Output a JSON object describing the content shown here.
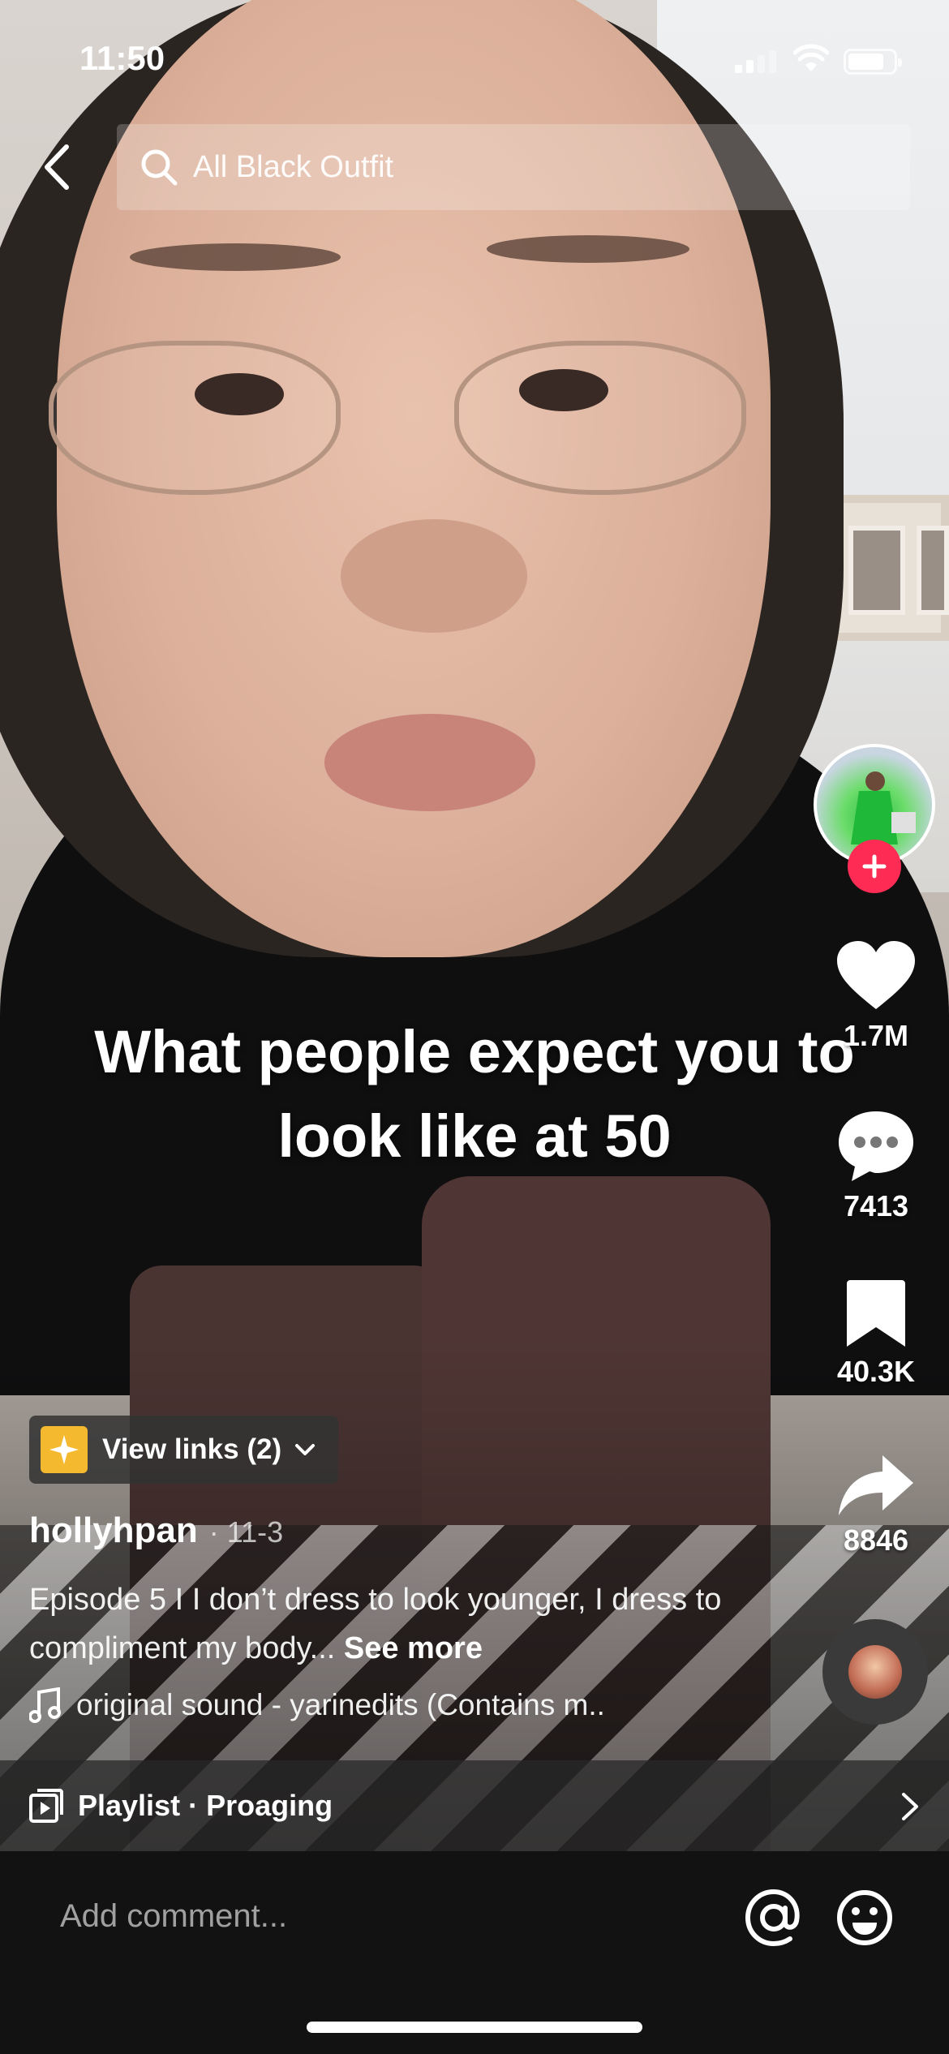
{
  "status_bar": {
    "time": "11:50",
    "battery_level": 0.8
  },
  "search": {
    "query": "All Black Outfit",
    "icon": "search-icon"
  },
  "video": {
    "caption_line1": "What people expect you to",
    "caption_line2": "look like at 50"
  },
  "actions": {
    "likes": "1.7M",
    "comments": "7413",
    "saves": "40.3K",
    "shares": "8846"
  },
  "info": {
    "links_label": "View links (2)",
    "author": "hollyhpan",
    "date": "· 11-3",
    "description": "Episode 5 I I don’t dress to look younger, I dress to compliment my body...",
    "see_more": "See more",
    "sound": "original sound - yarinedits (Contains m.."
  },
  "playlist": {
    "label": "Playlist · Proaging"
  },
  "comment_bar": {
    "placeholder": "Add comment..."
  },
  "colors": {
    "follow_accent": "#fe2c55",
    "links_icon_bg": "#f4b92f",
    "comment_bar_bg": "#121212"
  }
}
